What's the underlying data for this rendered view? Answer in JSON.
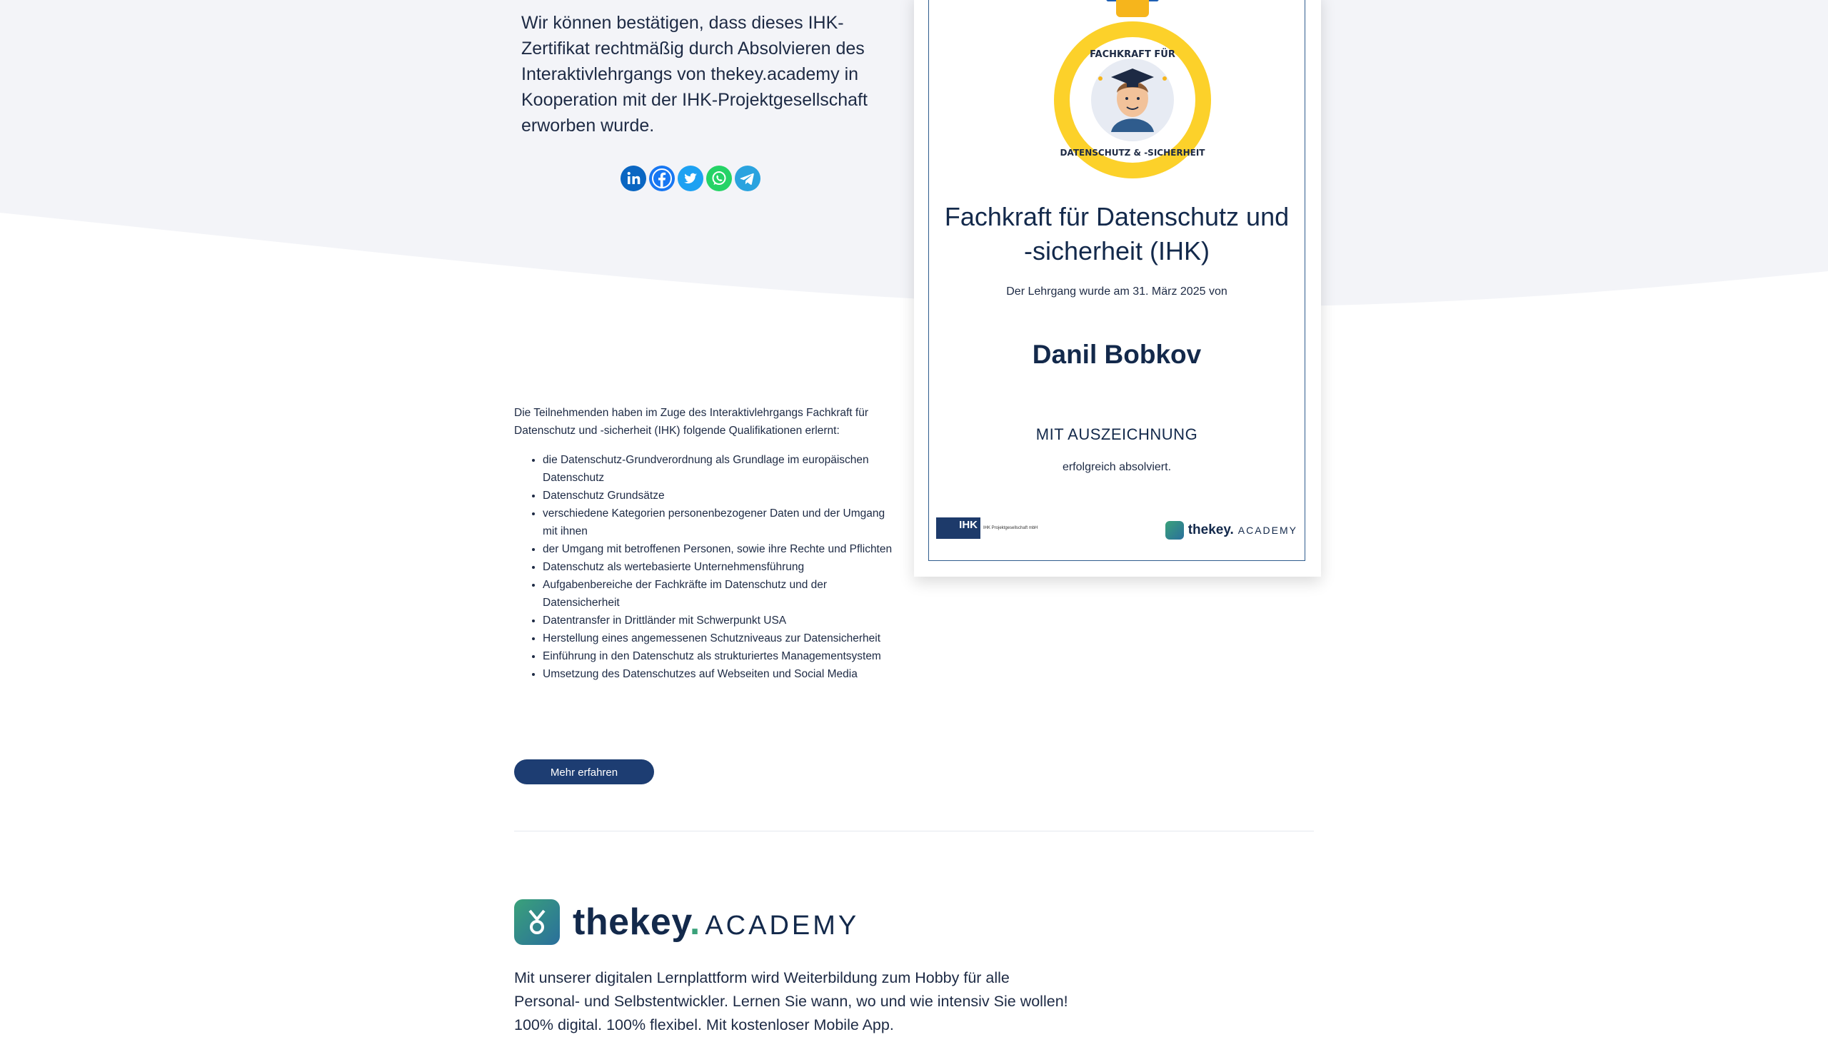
{
  "intro": {
    "text": "Wir können bestätigen, dass dieses IHK-Zertifikat rechtmäßig durch Absolvieren des Interaktivlehrgangs von thekey.academy in Kooperation mit der IHK-Projektgesellschaft erworben wurde."
  },
  "social": [
    {
      "name": "LinkedIn",
      "color": "#0a66c2",
      "icon": "linkedin-icon"
    },
    {
      "name": "Facebook",
      "color": "#1877f2",
      "icon": "facebook-icon"
    },
    {
      "name": "Twitter",
      "color": "#1da1f2",
      "icon": "twitter-icon"
    },
    {
      "name": "WhatsApp",
      "color": "#25d366",
      "icon": "whatsapp-icon"
    },
    {
      "name": "Telegram",
      "color": "#2aa3df",
      "icon": "telegram-icon"
    }
  ],
  "certificate": {
    "medal_text_top": "FACHKRAFT FÜR",
    "medal_text_bottom": "DATENSCHUTZ & -SICHERHEIT",
    "title_line1": "Fachkraft für Datenschutz und",
    "title_line2": "-sicherheit (IHK)",
    "subtitle": "Der Lehrgang wurde am 31. März 2025 von",
    "name": "Danil Bobkov",
    "award": "MIT AUSZEICHNUNG",
    "completed": "erfolgreich absolviert.",
    "ihk_logo_label": "IHK",
    "ihk_logo_text": "IHK Projektgesellschaft mbH",
    "brand_name": "thekey.",
    "brand_suffix": "ACADEMY"
  },
  "qualifications": {
    "intro": "Die Teilnehmenden haben im Zuge des Interaktivlehrgangs Fachkraft für Datenschutz und -sicherheit (IHK) folgende Qualifikationen erlernt:",
    "items": [
      "die Datenschutz-Grundverordnung als Grundlage im europäischen Datenschutz",
      "Datenschutz Grundsätze",
      "verschiedene Kategorien personenbezogener Daten und der Umgang mit ihnen",
      "der Umgang mit betroffenen Personen, sowie ihre Rechte und Pflichten",
      "Datenschutz als wertebasierte Unternehmensführung",
      "Aufgabenbereiche der Fachkräfte im Datenschutz und der Datensicherheit",
      "Datentransfer in Drittländer mit Schwerpunkt USA",
      "Herstellung eines angemessenen Schutzniveaus zur Datensicherheit",
      "Einführung in den Datenschutz als strukturiertes Managementsystem",
      "Umsetzung des Datenschutzes auf Webseiten und Social Media"
    ]
  },
  "more_button": "Mehr erfahren",
  "brand": {
    "word": "thekey",
    "dot": ".",
    "suffix": "ACADEMY",
    "line1": "Mit unserer digitalen Lernplattform wird Weiterbildung zum Hobby für alle",
    "line2": "Personal- und Selbstentwickler. Lernen Sie wann, wo und wie intensiv Sie wollen!",
    "line3": "100% digital. 100% flexibel. Mit kostenloser Mobile App."
  },
  "colors": {
    "navy": "#13294b",
    "button": "#1d3d72",
    "bg_gray": "#f3f4f8",
    "medal_gold": "#fcd12a",
    "brand_green": "#3aa17a"
  }
}
